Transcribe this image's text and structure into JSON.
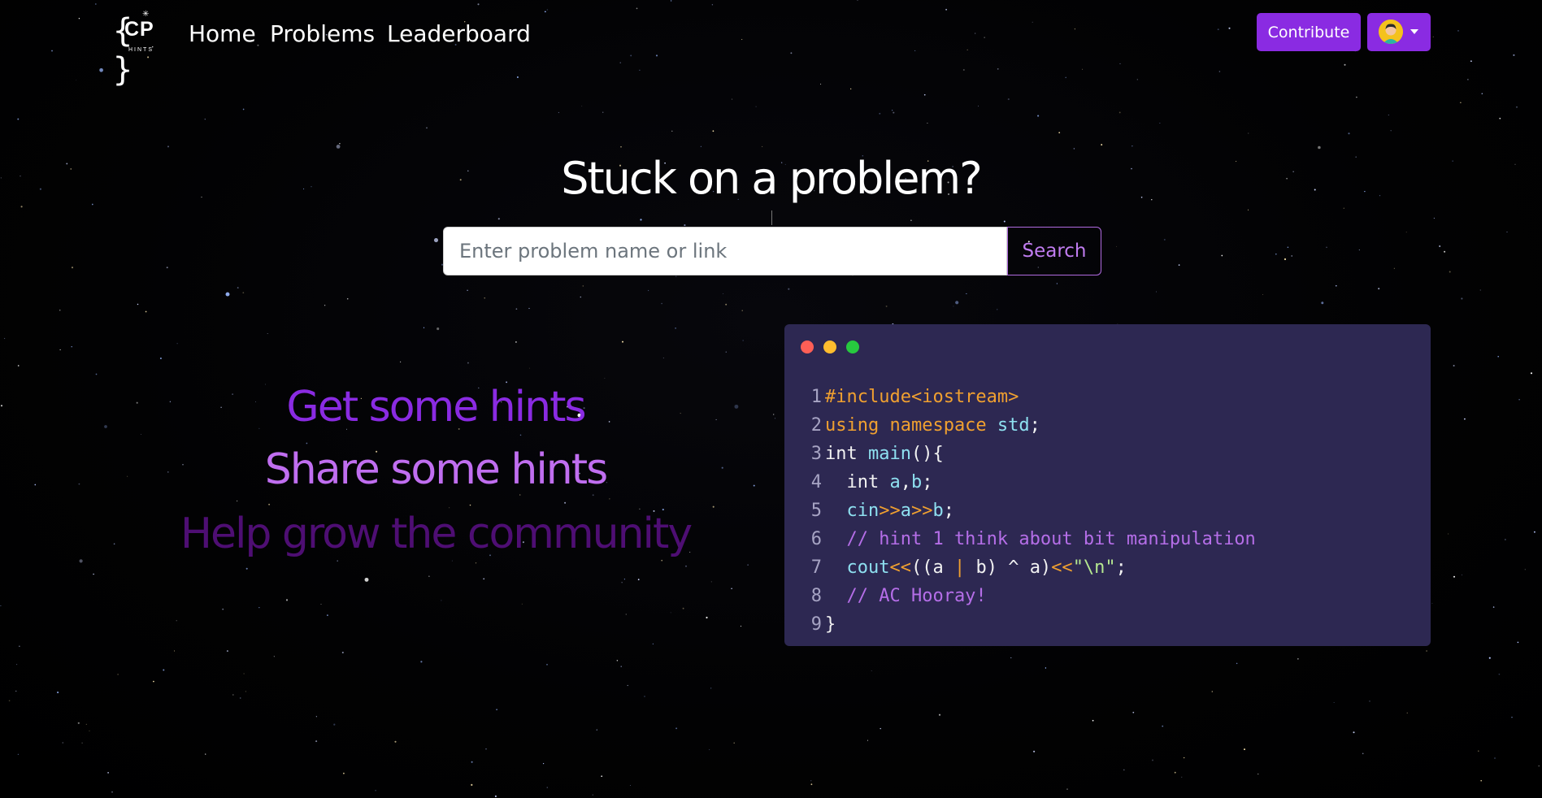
{
  "logo": {
    "braces": "{  }",
    "text": "CP",
    "subtext": "HINTS",
    "spark": "✳"
  },
  "nav": {
    "links": [
      "Home",
      "Problems",
      "Leaderboard"
    ],
    "contribute_label": "Contribute"
  },
  "hero": {
    "title": "Stuck on a problem?"
  },
  "search": {
    "placeholder": "Enter problem name or link",
    "value": "",
    "button_label": "Search"
  },
  "taglines": [
    "Get some hints",
    "Share some hints",
    "Help grow the community"
  ],
  "colors": {
    "accent": "#8a2be2",
    "tagline_1": "#8a2be2",
    "tagline_2": "#c06ef0",
    "tagline_3": "#4e0e73",
    "code_bg": "#2d2852"
  },
  "code_window": {
    "lines": [
      {
        "num": "1",
        "tokens": [
          {
            "t": "#include<iostream>",
            "c": "orange"
          }
        ]
      },
      {
        "num": "2",
        "tokens": [
          {
            "t": "using namespace ",
            "c": "orange"
          },
          {
            "t": "std",
            "c": "cyan"
          },
          {
            "t": ";",
            "c": "white"
          }
        ]
      },
      {
        "num": "3",
        "tokens": [
          {
            "t": "int ",
            "c": "white"
          },
          {
            "t": "main",
            "c": "cyan"
          },
          {
            "t": "(){",
            "c": "white"
          }
        ]
      },
      {
        "num": "4",
        "tokens": [
          {
            "t": "  int ",
            "c": "white"
          },
          {
            "t": "a",
            "c": "cyan"
          },
          {
            "t": ",",
            "c": "white"
          },
          {
            "t": "b",
            "c": "cyan"
          },
          {
            "t": ";",
            "c": "white"
          }
        ]
      },
      {
        "num": "5",
        "tokens": [
          {
            "t": "  cin",
            "c": "cyan"
          },
          {
            "t": ">>",
            "c": "orange"
          },
          {
            "t": "a",
            "c": "cyan"
          },
          {
            "t": ">>",
            "c": "orange"
          },
          {
            "t": "b",
            "c": "cyan"
          },
          {
            "t": ";",
            "c": "white"
          }
        ]
      },
      {
        "num": "6",
        "tokens": [
          {
            "t": "  // hint 1 think about bit manipulation",
            "c": "comment"
          }
        ]
      },
      {
        "num": "7",
        "tokens": [
          {
            "t": "  cout",
            "c": "cyan"
          },
          {
            "t": "<<",
            "c": "orange"
          },
          {
            "t": "((a ",
            "c": "white"
          },
          {
            "t": "|",
            "c": "orange"
          },
          {
            "t": " b) ^ a)",
            "c": "white"
          },
          {
            "t": "<<",
            "c": "orange"
          },
          {
            "t": "\"\\n\"",
            "c": "green"
          },
          {
            "t": ";",
            "c": "white"
          }
        ]
      },
      {
        "num": "8",
        "tokens": [
          {
            "t": "  // AC Hooray!",
            "c": "comment"
          }
        ]
      },
      {
        "num": "9",
        "tokens": [
          {
            "t": "}",
            "c": "white"
          }
        ]
      }
    ]
  }
}
